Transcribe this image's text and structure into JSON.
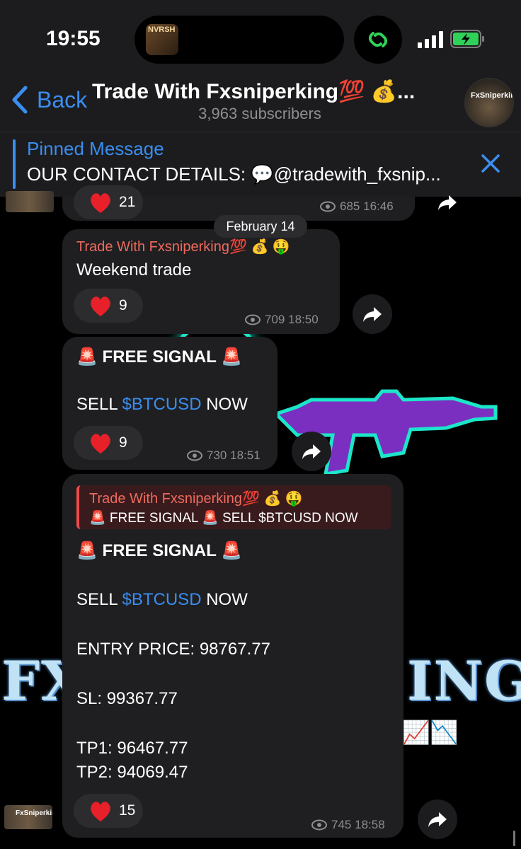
{
  "status_bar": {
    "time": "19:55",
    "album_art_text": "NVRSH"
  },
  "header": {
    "back_label": "Back",
    "title": "Trade With Fxsniperking💯 💰...",
    "subscribers": "3,963 subscribers",
    "avatar_text": "FxSniperking"
  },
  "pinned": {
    "title": "Pinned Message",
    "text": "OUR CONTACT DETAILS: 💬@tradewith_fxsnip..."
  },
  "background": {
    "word_left": "FX",
    "word_right": "ING",
    "trend": "📈📉"
  },
  "date_separator": "February 14",
  "messages": [
    {
      "reaction_count": "21",
      "views": "685",
      "time": "16:46"
    },
    {
      "sender": "Trade With Fxsniperking💯 💰 🤑",
      "text": "Weekend trade",
      "reaction_count": "9",
      "views": "709",
      "time": "18:50"
    },
    {
      "line1": "🚨 FREE SIGNAL 🚨",
      "line2_pre": "SELL ",
      "line2_link": "$BTCUSD",
      "line2_post": " NOW",
      "reaction_count": "9",
      "views": "730",
      "time": "18:51"
    },
    {
      "quote_sender": "Trade With Fxsniperking💯 💰 🤑",
      "quote_text": "🚨 FREE SIGNAL 🚨  SELL $BTCUSD NOW",
      "line1": "🚨 FREE SIGNAL 🚨",
      "line2_pre": "SELL ",
      "line2_link": "$BTCUSD",
      "line2_post": " NOW",
      "entry": "ENTRY PRICE: 98767.77",
      "sl": "SL: 99367.77",
      "tp1": "TP1: 96467.77",
      "tp2": "TP2: 94069.47",
      "reaction_count": "15",
      "views": "745",
      "time": "18:58",
      "avatar_text": "FxSniperking"
    }
  ],
  "colors": {
    "accent": "#3a8ef0",
    "sender": "#ee6a5e",
    "bubble": "#1f1f21"
  }
}
